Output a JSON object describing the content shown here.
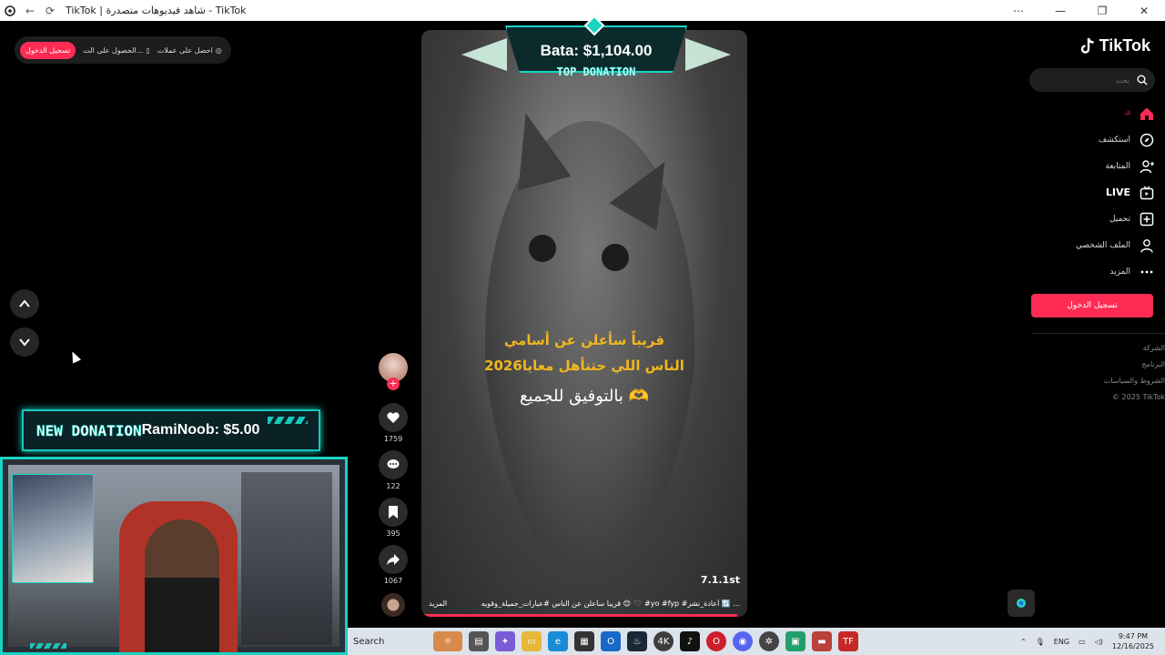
{
  "window": {
    "title": "TikTok | شاهد فيديوهات متصدرة - TikTok"
  },
  "top_pill": {
    "login": "تسجيل الدخول",
    "get_app": "الحصول على الت...",
    "get_coins": "احصل على عملات"
  },
  "donation_overlay": {
    "new_label": "NEW DONATION",
    "new_entry": "RamiNoob: $5.00",
    "top_amount": "Bata: $1,104.00",
    "top_label": "TOP DONATION"
  },
  "video": {
    "caption_line1": "قريباً سأعلن عن أسامي",
    "caption_line2": "الناس اللي حتتأهل معايا2026",
    "caption_line3": "بالتوفيق للجميع 🫶",
    "time": "7.1.1st",
    "description": "قريباً سأعلن عن الناس #عبارات_جميلة_وقويه 😊 🖤 #yo #fyp #أعادة_نشر 🔃 ...",
    "more": "المزيد",
    "progress": 0.97
  },
  "actions": {
    "likes": "1759",
    "comments": "122",
    "saves": "395",
    "shares": "1067"
  },
  "sidebar": {
    "brand": "TikTok",
    "search_placeholder": "بحث",
    "items": [
      {
        "label": "لك",
        "icon": "home-icon"
      },
      {
        "label": "استكشف",
        "icon": "compass-icon"
      },
      {
        "label": "المتابعة",
        "icon": "following-icon"
      },
      {
        "label": "LIVE",
        "icon": "live-icon"
      },
      {
        "label": "تحميل",
        "icon": "upload-icon"
      },
      {
        "label": "الملف الشخصي",
        "icon": "profile-icon"
      },
      {
        "label": "المزيد",
        "icon": "more-icon"
      }
    ],
    "login": "تسجيل الدخول",
    "footer": [
      "الشركة",
      "البرنامج",
      "الشروط والسياسات",
      "© 2025 TikTok"
    ]
  },
  "taskbar": {
    "search": "Search",
    "lang": "ENG",
    "time": "9:47 PM",
    "date": "12/16/2025"
  },
  "colors": {
    "accent": "#fe2c55",
    "overlay_teal": "#17d4c3",
    "caption_gold": "#f1b71c"
  }
}
